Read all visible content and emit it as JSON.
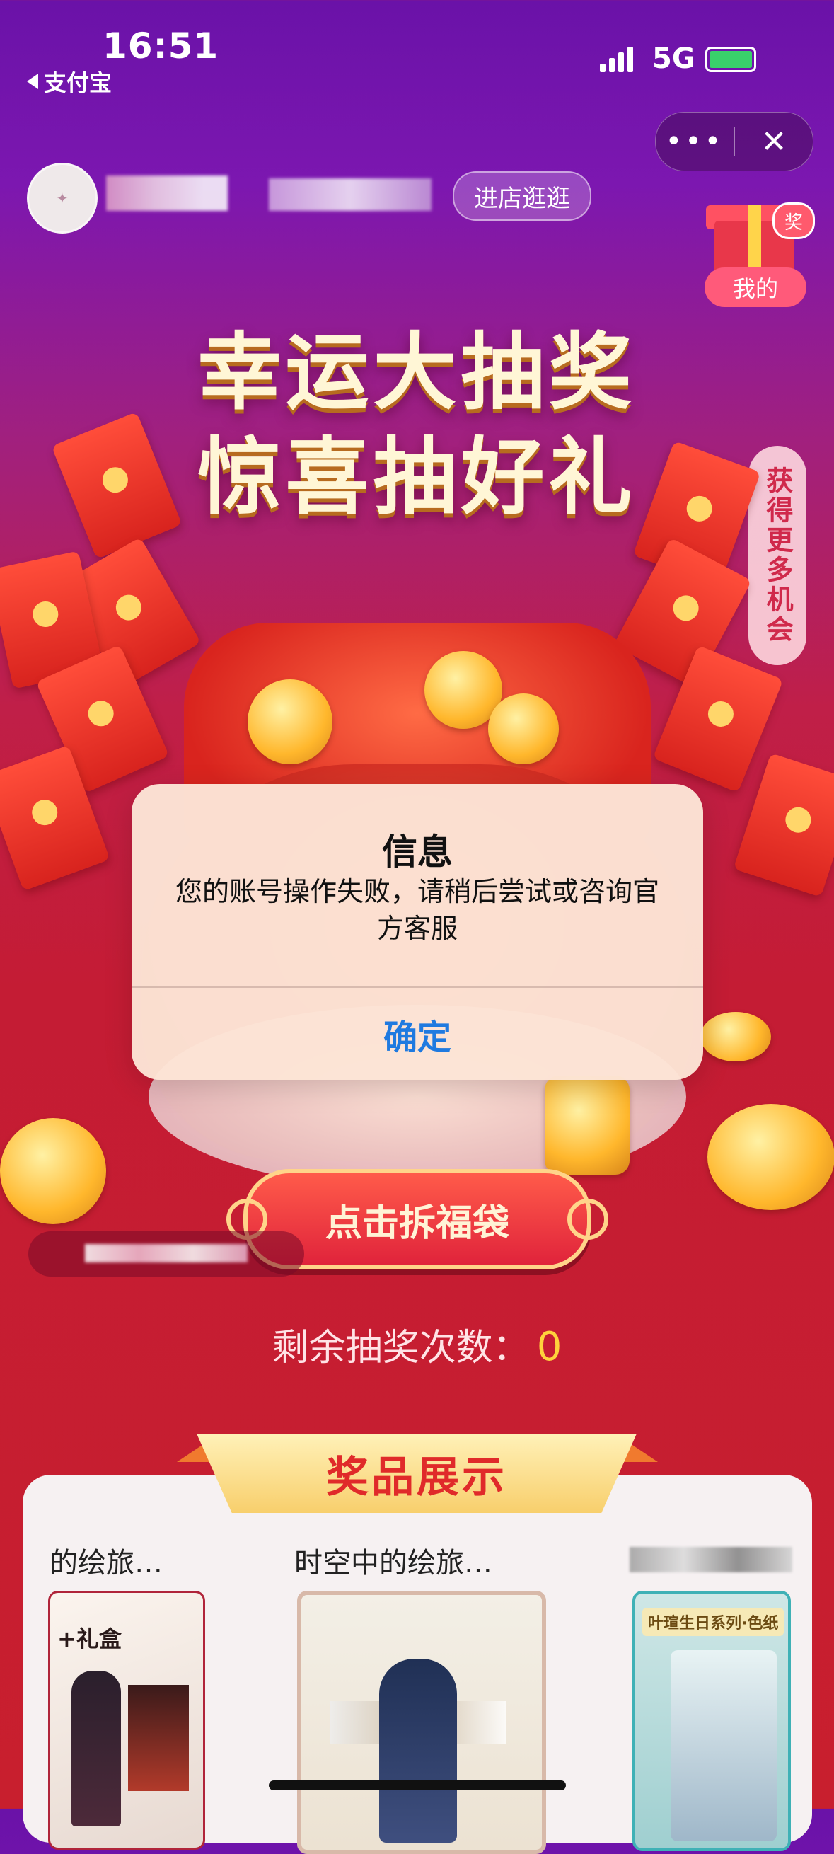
{
  "status_bar": {
    "time": "16:51",
    "back_app": "支付宝",
    "network": "5G"
  },
  "capsule": {
    "more": "•••",
    "close": "✕"
  },
  "store": {
    "enter_label": "进店逛逛"
  },
  "my_prize": {
    "badge": "奖",
    "label": "我的"
  },
  "headline": {
    "line1": "幸运大抽奖",
    "line2": "惊喜抽好礼"
  },
  "side_tab": {
    "label": "获得更多机会"
  },
  "draw_button": {
    "label": "点击拆福袋"
  },
  "remaining": {
    "label": "剩余抽奖次数：",
    "count": "0"
  },
  "showcase": {
    "title": "奖品展示",
    "items": [
      {
        "name": "的绘旅…"
      },
      {
        "name": "时空中的绘旅…"
      }
    ],
    "giftbox_label": "+礼盒",
    "series_label": "叶瑄生日系列·色纸"
  },
  "dialog": {
    "title": "信息",
    "message": "您的账号操作失败，请稍后尝试或咨询官方客服",
    "ok_label": "确定"
  },
  "colors": {
    "accent": "#1f7ae0",
    "brand_red": "#d8231e",
    "gold": "#ffd23c"
  }
}
